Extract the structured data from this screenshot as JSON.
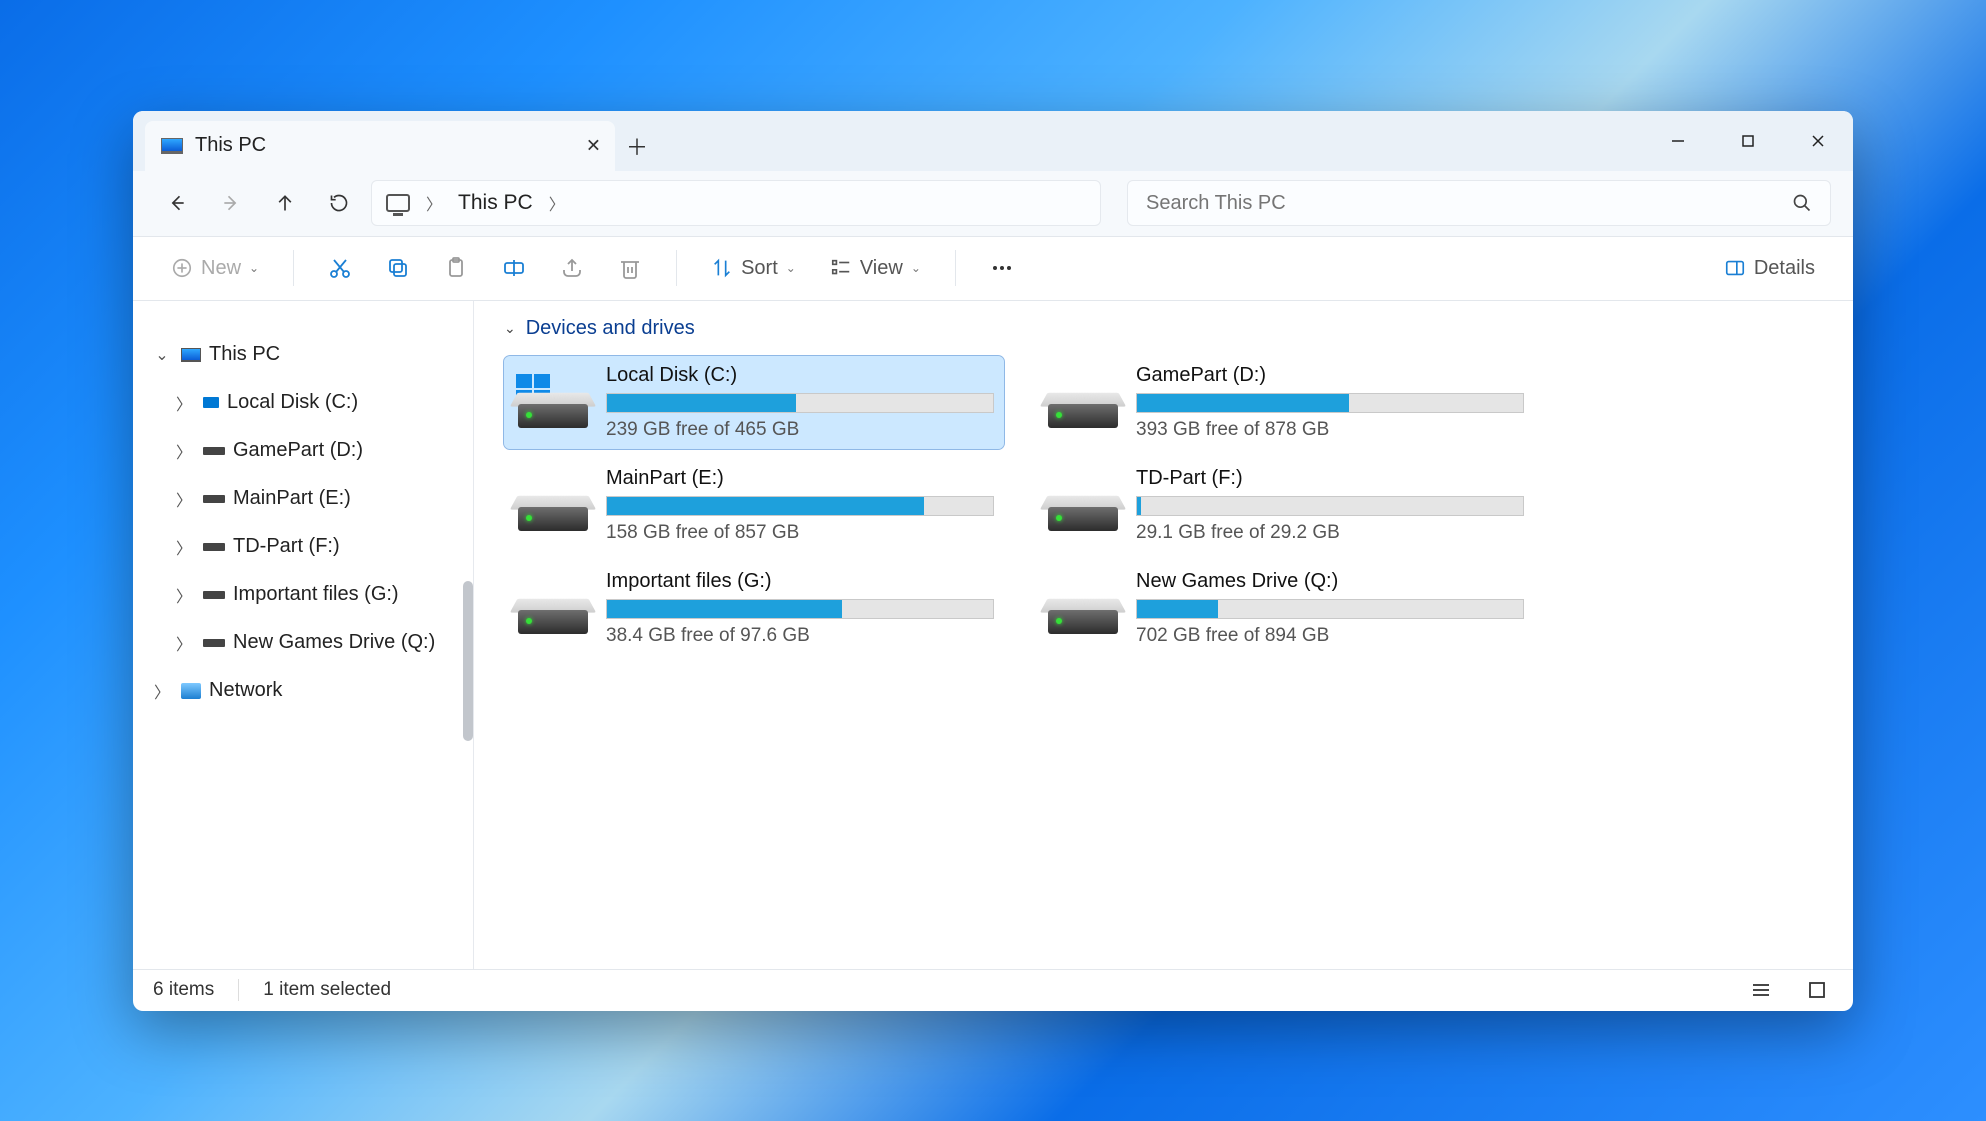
{
  "window": {
    "tab_title": "This PC"
  },
  "navbar": {
    "crumb_main": "This PC",
    "search_placeholder": "Search This PC"
  },
  "toolbar": {
    "new_label": "New",
    "sort_label": "Sort",
    "view_label": "View",
    "details_label": "Details"
  },
  "sidebar": {
    "root_label": "This PC",
    "drives": [
      {
        "label": "Local Disk (C:)"
      },
      {
        "label": "GamePart (D:)"
      },
      {
        "label": "MainPart (E:)"
      },
      {
        "label": "TD-Part (F:)"
      },
      {
        "label": "Important files (G:)"
      },
      {
        "label": "New Games Drive (Q:)"
      }
    ],
    "network_label": "Network"
  },
  "section": {
    "title": "Devices and drives"
  },
  "drives": [
    {
      "name": "Local Disk (C:)",
      "free": "239 GB free of 465 GB",
      "used_pct": 49,
      "selected": true,
      "is_system": true
    },
    {
      "name": "GamePart (D:)",
      "free": "393 GB free of 878 GB",
      "used_pct": 55,
      "selected": false,
      "is_system": false
    },
    {
      "name": "MainPart (E:)",
      "free": "158 GB free of 857 GB",
      "used_pct": 82,
      "selected": false,
      "is_system": false
    },
    {
      "name": "TD-Part (F:)",
      "free": "29.1 GB free of 29.2 GB",
      "used_pct": 1,
      "selected": false,
      "is_system": false
    },
    {
      "name": "Important files (G:)",
      "free": "38.4 GB free of 97.6 GB",
      "used_pct": 61,
      "selected": false,
      "is_system": false
    },
    {
      "name": "New Games Drive (Q:)",
      "free": "702 GB free of 894 GB",
      "used_pct": 21,
      "selected": false,
      "is_system": false
    }
  ],
  "status": {
    "items": "6 items",
    "selected": "1 item selected"
  }
}
